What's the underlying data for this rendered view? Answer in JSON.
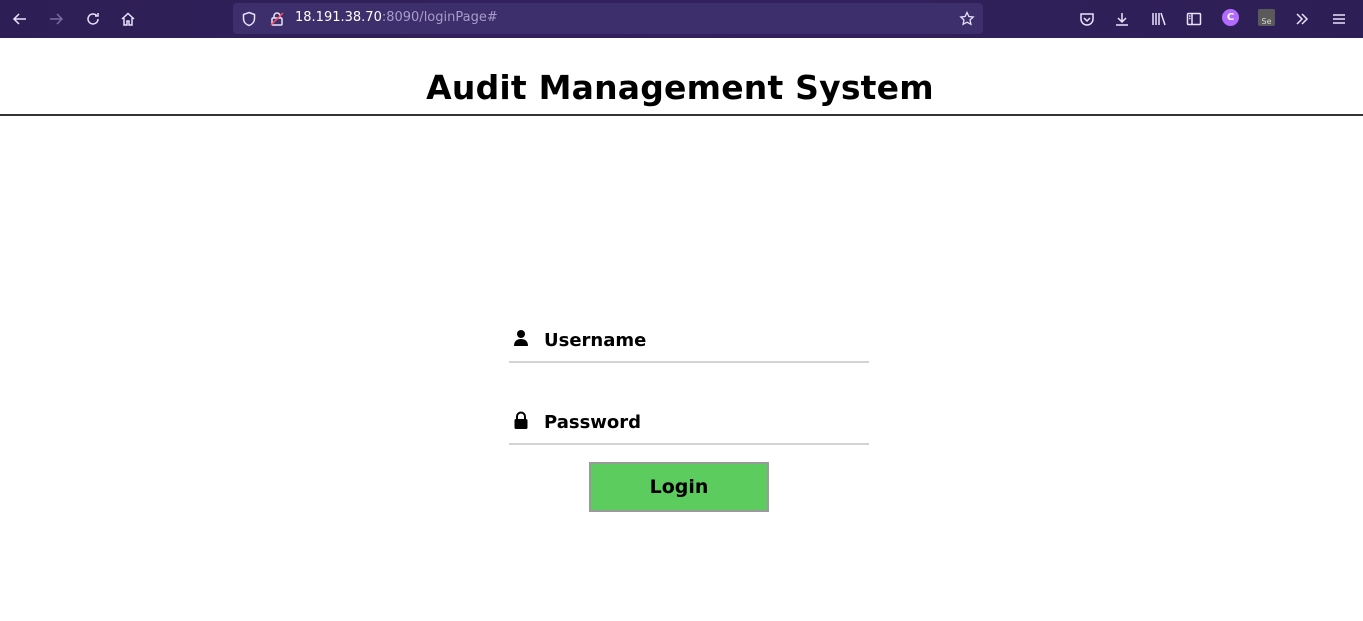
{
  "browser": {
    "url_host": "18.191.38.70",
    "url_rest": ":8090/loginPage#",
    "avatar_letter": "C",
    "extension_label": "Se"
  },
  "page": {
    "title": "Audit Management System"
  },
  "form": {
    "username_placeholder": "Username",
    "password_placeholder": "Password",
    "login_label": "Login"
  },
  "colors": {
    "toolbar": "#2d1f55",
    "login_button": "#5ccc5e"
  },
  "icons": {
    "back": "arrow-left-icon",
    "forward": "arrow-right-icon",
    "reload": "reload-icon",
    "home": "home-icon",
    "shield": "shield-icon",
    "lock": "lock-icon",
    "bookmark": "star-icon",
    "pocket": "pocket-icon",
    "downloads": "download-icon",
    "library": "library-icon",
    "sidebar": "sidebar-icon",
    "overflow": "chevron-double-right-icon",
    "menu": "hamburger-icon",
    "user": "user-icon",
    "password": "padlock-icon"
  }
}
